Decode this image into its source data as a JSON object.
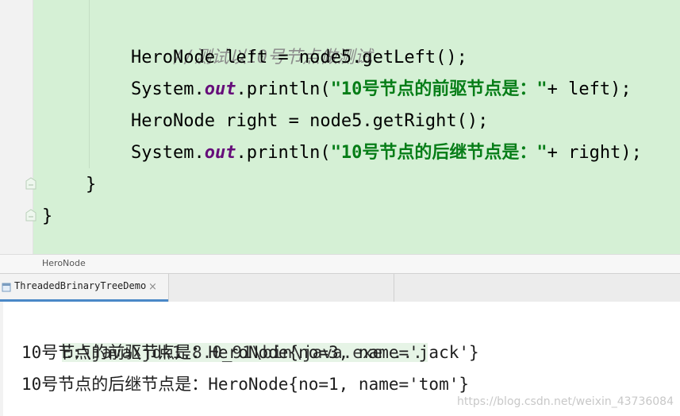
{
  "editor": {
    "lines": {
      "comment": "//测试以10号节点做测试",
      "l1": "HeroNode left = node5.getLeft();",
      "l2_prefix": "System.",
      "l2_field": "out",
      "l2_mid": ".println(",
      "l2_string": "\"10号节点的前驱节点是：\"",
      "l2_suffix": "+ left);",
      "l3": "HeroNode right = node5.getRight();",
      "l4_prefix": "System.",
      "l4_field": "out",
      "l4_mid": ".println(",
      "l4_string": "\"10号节点的后继节点是：\"",
      "l4_suffix": "+ right);",
      "close_method": "}",
      "close_class": "}"
    }
  },
  "breadcrumb": {
    "label": "HeroNode"
  },
  "run_tab": {
    "label": "ThreadedBrinaryTreeDemo",
    "close": "×",
    "icon": "run-config-icon"
  },
  "console": {
    "command": "E:\\java\\jdk1.8.0_91\\bin\\java.exe ...",
    "out1": "10号节点的前驱节点是：HeroNode{no=3, name='jack'}",
    "out2": "10号节点的后继节点是：HeroNode{no=1, name='tom'}"
  },
  "watermark": {
    "text": "https://blog.csdn.net/weixin_43736084"
  },
  "colors": {
    "editor_bg": "#d5f0d5",
    "keyword_field": "#660e7a",
    "string": "#067d17",
    "comment": "#8c8c8c",
    "tab_accent": "#4a88c7"
  }
}
